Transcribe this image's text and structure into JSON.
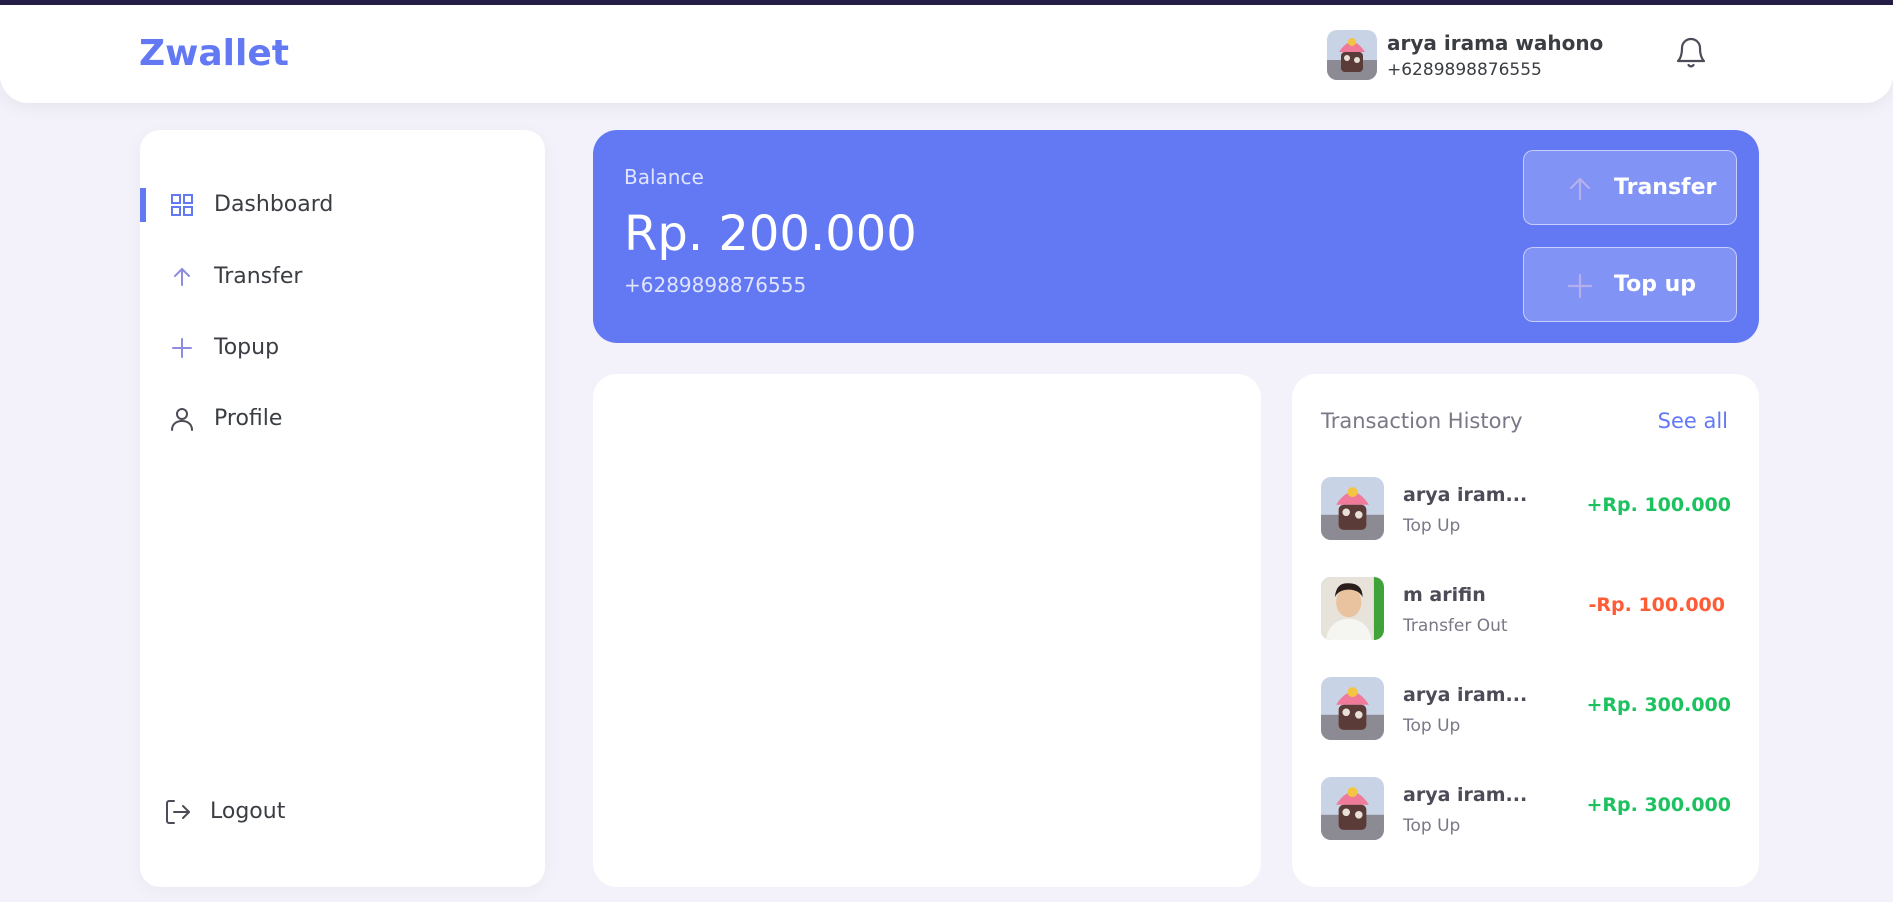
{
  "header": {
    "logo": "Zwallet",
    "user_name": "arya irama wahono",
    "user_phone": "+6289898876555",
    "icons": {
      "avatar": "user-avatar",
      "notification": "bell-icon"
    }
  },
  "sidebar": {
    "items": [
      {
        "label": "Dashboard",
        "icon": "grid-icon",
        "active": true
      },
      {
        "label": "Transfer",
        "icon": "arrow-up-icon",
        "active": false
      },
      {
        "label": "Topup",
        "icon": "plus-icon",
        "active": false
      },
      {
        "label": "Profile",
        "icon": "user-icon",
        "active": false
      }
    ],
    "logout_label": "Logout"
  },
  "balance": {
    "label": "Balance",
    "amount": "Rp. 200.000",
    "phone": "+6289898876555",
    "transfer_label": "Transfer",
    "topup_label": "Top up"
  },
  "history": {
    "title": "Transaction History",
    "see_all": "See all",
    "items": [
      {
        "name": "arya iram...",
        "type": "Top Up",
        "amount": "+Rp. 100.000",
        "direction": "in"
      },
      {
        "name": "m arifin",
        "type": "Transfer Out",
        "amount": "-Rp. 100.000",
        "direction": "out"
      },
      {
        "name": "arya iram...",
        "type": "Top Up",
        "amount": "+Rp. 300.000",
        "direction": "in"
      },
      {
        "name": "arya iram...",
        "type": "Top Up",
        "amount": "+Rp. 300.000",
        "direction": "in"
      }
    ]
  },
  "colors": {
    "primary": "#6379F4",
    "positive": "#1EC15F",
    "negative": "#FF5B37",
    "background": "#F3F2FA"
  }
}
